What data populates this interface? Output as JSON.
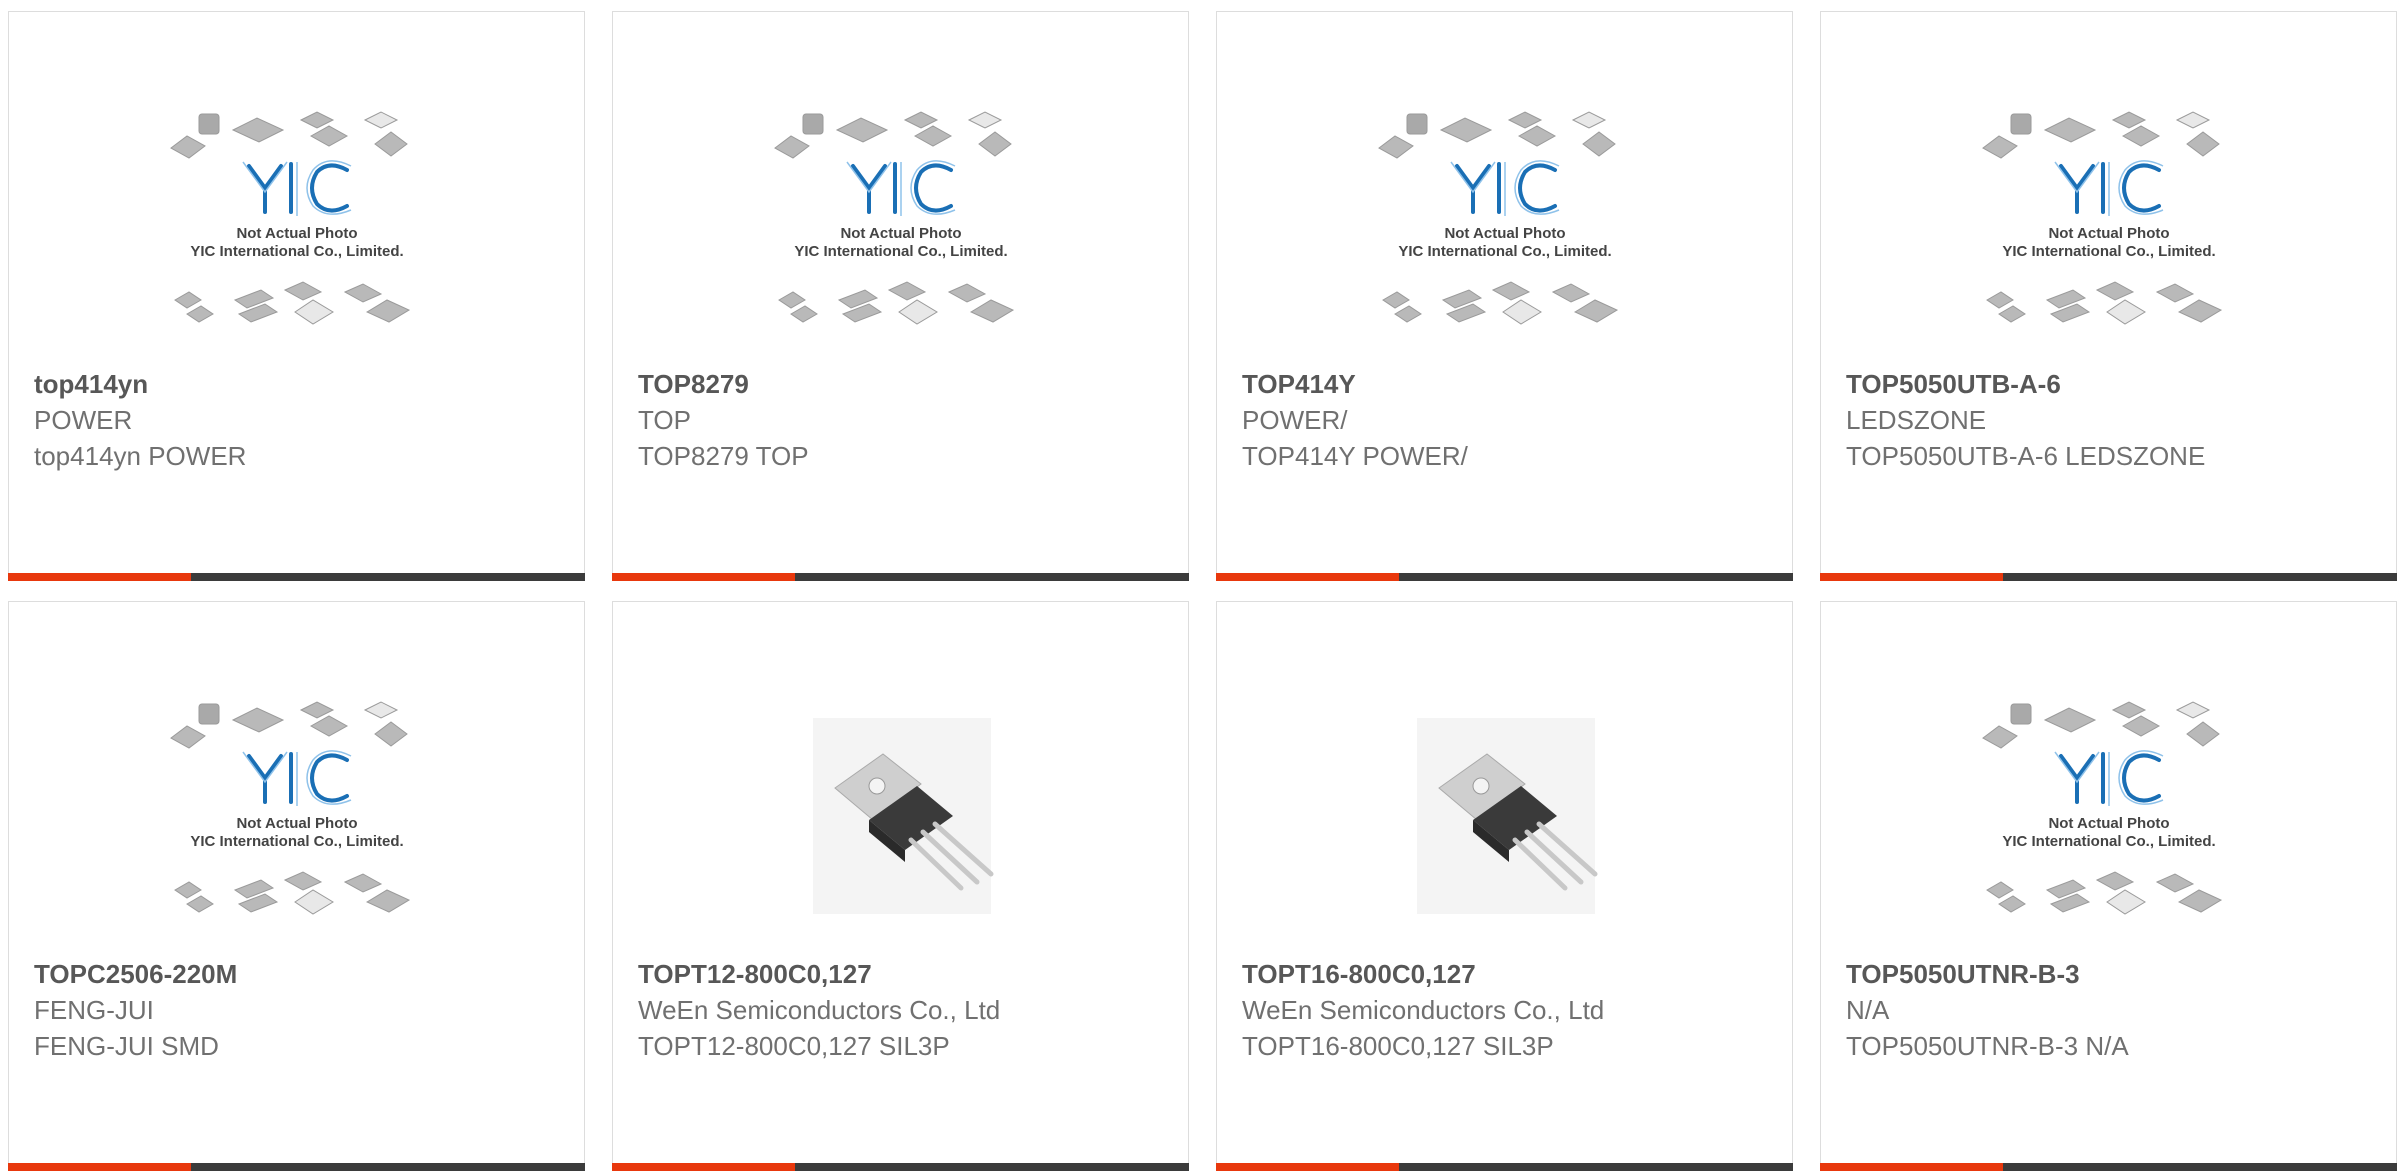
{
  "colors": {
    "accent": "#e8380d",
    "bar_dark": "#3b3b3b",
    "logo_blue": "#1a6fb5"
  },
  "products": [
    {
      "part": "top414yn",
      "manufacturer": "POWER",
      "description": "top414yn POWER",
      "image": "yic-placeholder",
      "photo_caption_1": "Not Actual Photo",
      "photo_caption_2": "YIC International Co., Limited.",
      "logo": "YIC"
    },
    {
      "part": "TOP8279",
      "manufacturer": "TOP",
      "description": "TOP8279 TOP",
      "image": "yic-placeholder",
      "photo_caption_1": "Not Actual Photo",
      "photo_caption_2": "YIC International Co., Limited.",
      "logo": "YIC"
    },
    {
      "part": "TOP414Y",
      "manufacturer": "POWER/",
      "description": "TOP414Y POWER/",
      "image": "yic-placeholder",
      "photo_caption_1": "Not Actual Photo",
      "photo_caption_2": "YIC International Co., Limited.",
      "logo": "YIC"
    },
    {
      "part": "TOP5050UTB-A-6",
      "manufacturer": "LEDSZONE",
      "description": "TOP5050UTB-A-6 LEDSZONE",
      "image": "yic-placeholder",
      "photo_caption_1": "Not Actual Photo",
      "photo_caption_2": "YIC International Co., Limited.",
      "logo": "YIC"
    },
    {
      "part": "TOPC2506-220M",
      "manufacturer": "FENG-JUI",
      "description": "FENG-JUI SMD",
      "image": "yic-placeholder",
      "photo_caption_1": "Not Actual Photo",
      "photo_caption_2": "YIC International Co., Limited.",
      "logo": "YIC"
    },
    {
      "part": "TOPT12-800C0,127",
      "manufacturer": "WeEn Semiconductors Co., Ltd",
      "description": "TOPT12-800C0,127 SIL3P",
      "image": "to220-photo"
    },
    {
      "part": "TOPT16-800C0,127",
      "manufacturer": "WeEn Semiconductors Co., Ltd",
      "description": "TOPT16-800C0,127 SIL3P",
      "image": "to220-photo"
    },
    {
      "part": "TOP5050UTNR-B-3",
      "manufacturer": "N/A",
      "description": "TOP5050UTNR-B-3 N/A",
      "image": "yic-placeholder",
      "photo_caption_1": "Not Actual Photo",
      "photo_caption_2": "YIC International Co., Limited.",
      "logo": "YIC"
    }
  ]
}
